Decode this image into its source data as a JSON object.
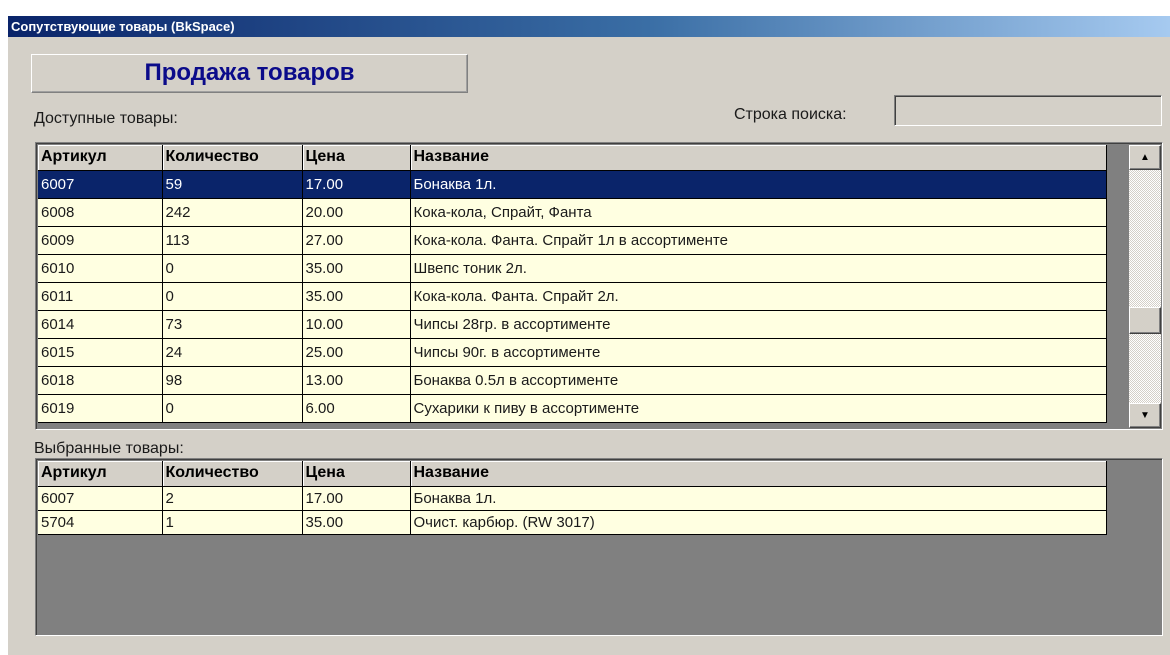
{
  "window": {
    "title": "Сопутствующие товары (BkSpace)"
  },
  "header": {
    "title": "Продажа товаров"
  },
  "available": {
    "label": "Доступные товары:",
    "columns": [
      "Артикул",
      "Количество",
      "Цена",
      "Название"
    ],
    "rows": [
      [
        "6007",
        "59",
        "17.00",
        "Бонаква 1л."
      ],
      [
        "6008",
        "242",
        "20.00",
        "Кока-кола,  Спрайт,  Фанта"
      ],
      [
        "6009",
        "113",
        "27.00",
        "Кока-кола. Фанта. Спрайт 1л в ассортименте"
      ],
      [
        "6010",
        "0",
        "35.00",
        "Швепс тоник 2л."
      ],
      [
        "6011",
        "0",
        "35.00",
        "Кока-кола. Фанта. Спрайт 2л."
      ],
      [
        "6014",
        "73",
        "10.00",
        "Чипсы 28гр.  в ассортименте"
      ],
      [
        "6015",
        "24",
        "25.00",
        "Чипсы 90г.  в ассортименте"
      ],
      [
        "6018",
        "98",
        "13.00",
        "Бонаква 0.5л в ассортименте"
      ],
      [
        "6019",
        "0",
        "6.00",
        "Сухарики к пиву в ассортименте"
      ]
    ],
    "selected_row": 0
  },
  "search": {
    "label": "Строка поиска:",
    "value": ""
  },
  "selected": {
    "label": "Выбранные товары:",
    "columns": [
      "Артикул",
      "Количество",
      "Цена",
      "Название"
    ],
    "rows": [
      [
        "6007",
        "2",
        "17.00",
        "Бонаква 1л."
      ],
      [
        "5704",
        "1",
        "35.00",
        "Очист. карбюр. (RW 3017)"
      ]
    ]
  },
  "icons": {
    "scroll_up": "arrow-up-icon",
    "scroll_down": "arrow-down-icon"
  },
  "colors": {
    "title_bar": "#0a246a",
    "header_text": "#0b0b8a",
    "row_background": "#ffffe1",
    "selected_row": "#0a246a",
    "window_face": "#d4d0c8"
  }
}
